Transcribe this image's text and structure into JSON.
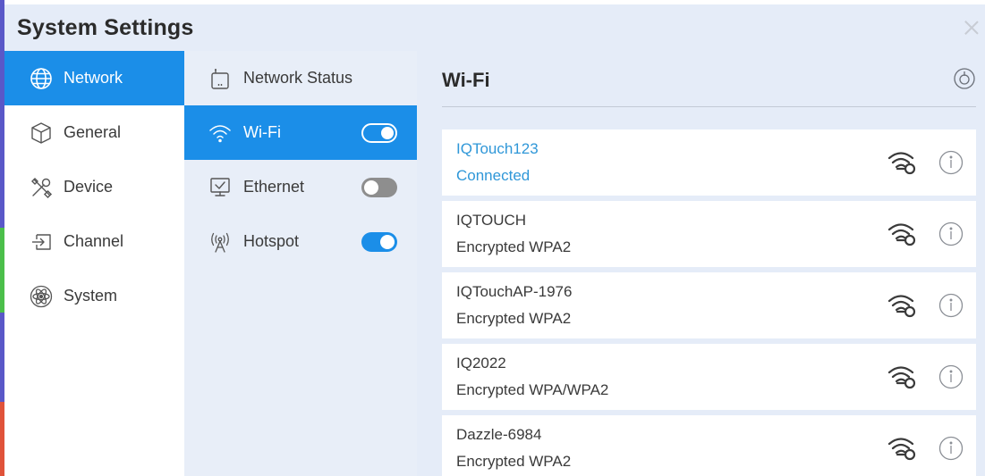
{
  "window": {
    "title": "System Settings"
  },
  "colors": {
    "accent": "#1b8ee8",
    "connected_text": "#2f97d8"
  },
  "nav": {
    "items": [
      {
        "label": "Network",
        "icon": "globe-icon",
        "active": true
      },
      {
        "label": "General",
        "icon": "cube-icon",
        "active": false
      },
      {
        "label": "Device",
        "icon": "tools-icon",
        "active": false
      },
      {
        "label": "Channel",
        "icon": "input-icon",
        "active": false
      },
      {
        "label": "System",
        "icon": "atom-icon",
        "active": false
      }
    ]
  },
  "subnav": {
    "items": [
      {
        "label": "Network Status",
        "icon": "router-icon",
        "active": false
      },
      {
        "label": "Wi-Fi",
        "icon": "wifi-icon",
        "active": true,
        "toggle": "on"
      },
      {
        "label": "Ethernet",
        "icon": "monitor-icon",
        "active": false,
        "toggle": "off"
      },
      {
        "label": "Hotspot",
        "icon": "hotspot-icon",
        "active": false,
        "toggle": "on"
      }
    ]
  },
  "wifi_panel": {
    "title": "Wi-Fi",
    "networks": [
      {
        "name": "IQTouch123",
        "status": "Connected",
        "connected": true
      },
      {
        "name": "IQTOUCH",
        "status": "Encrypted WPA2",
        "connected": false
      },
      {
        "name": "IQTouchAP-1976",
        "status": "Encrypted WPA2",
        "connected": false
      },
      {
        "name": "IQ2022",
        "status": "Encrypted WPA/WPA2",
        "connected": false
      },
      {
        "name": "Dazzle-6984",
        "status": "Encrypted WPA2",
        "connected": false
      }
    ]
  }
}
